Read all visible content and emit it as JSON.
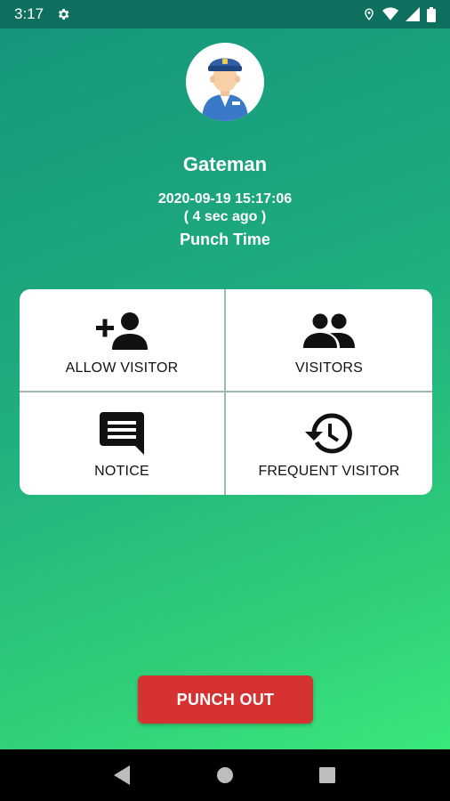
{
  "status_bar": {
    "time": "3:17",
    "icons": [
      "gear-icon",
      "location-icon",
      "wifi-icon",
      "signal-icon",
      "battery-icon"
    ]
  },
  "profile": {
    "avatar_icon": "security-guard-avatar",
    "name": "Gateman",
    "punch_datetime": "2020-09-19 15:17:06",
    "punch_ago": "( 4 sec ago )",
    "punch_label": "Punch Time"
  },
  "menu": {
    "items": [
      {
        "label": "ALLOW VISITOR",
        "icon": "add-person-icon"
      },
      {
        "label": "VISITORS",
        "icon": "people-icon"
      },
      {
        "label": "NOTICE",
        "icon": "message-icon"
      },
      {
        "label": "FREQUENT VISITOR",
        "icon": "history-icon"
      }
    ]
  },
  "actions": {
    "punch_out_label": "PUNCH OUT"
  },
  "colors": {
    "status_bar": "#0f6f5f",
    "gradient_start": "#16967c",
    "gradient_end": "#3ae87a",
    "punch_out": "#d63232"
  },
  "nav_bar": {
    "icons": [
      "back-icon",
      "home-icon",
      "recents-icon"
    ]
  }
}
